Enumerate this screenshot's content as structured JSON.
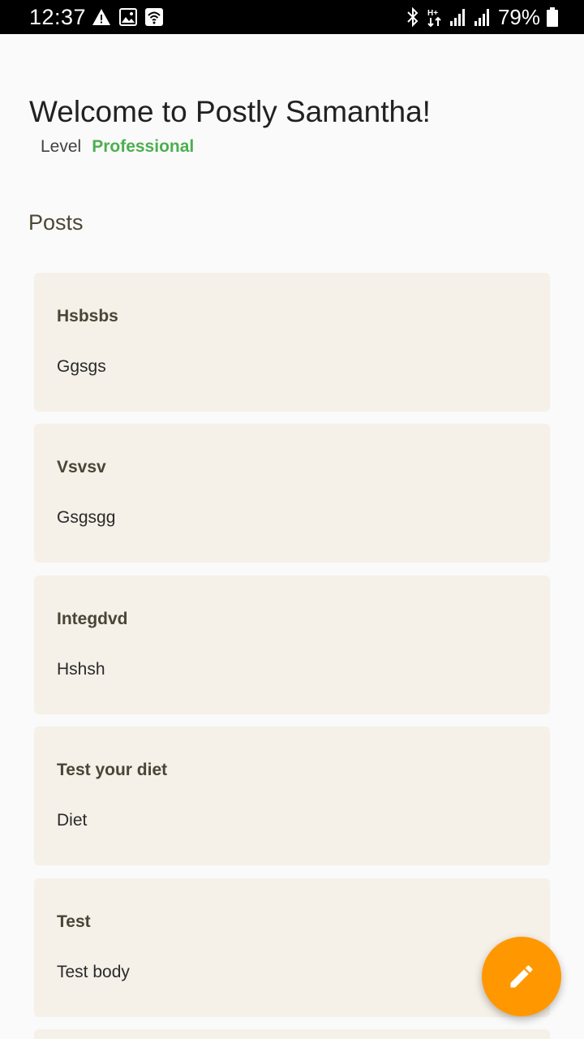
{
  "status_bar": {
    "time": "12:37",
    "battery": "79%",
    "icons_left": [
      "warning-icon",
      "image-icon",
      "wifi-calling-icon"
    ],
    "icons_right": [
      "bluetooth-icon",
      "data-arrows-icon",
      "signal-icon",
      "signal-icon",
      "battery-icon"
    ]
  },
  "header": {
    "title": "Welcome to Postly Samantha!",
    "level_label": "Level",
    "level_value": "Professional",
    "level_color": "#4caf50"
  },
  "posts_section": {
    "title": "Posts",
    "items": [
      {
        "title": "Hsbsbs",
        "body": "Ggsgs"
      },
      {
        "title": "Vsvsv",
        "body": "Gsgsgg"
      },
      {
        "title": "Integdvd",
        "body": "Hshsh"
      },
      {
        "title": "Test your diet",
        "body": "Diet"
      },
      {
        "title": "Test",
        "body": "Test body"
      }
    ]
  },
  "fab": {
    "icon": "edit-pencil-icon",
    "color": "#ff9800"
  }
}
